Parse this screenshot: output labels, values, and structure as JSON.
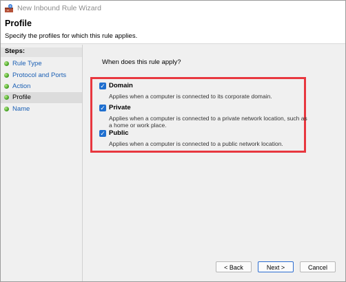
{
  "window": {
    "title": "New Inbound Rule Wizard"
  },
  "header": {
    "title": "Profile",
    "description": "Specify the profiles for which this rule applies."
  },
  "sidebar": {
    "steps_label": "Steps:",
    "steps": [
      {
        "label": "Rule Type",
        "active": false
      },
      {
        "label": "Protocol and Ports",
        "active": false
      },
      {
        "label": "Action",
        "active": false
      },
      {
        "label": "Profile",
        "active": true
      },
      {
        "label": "Name",
        "active": false
      }
    ]
  },
  "main": {
    "question": "When does this rule apply?",
    "options": [
      {
        "title": "Domain",
        "checked": true,
        "description": "Applies when a computer is connected to its corporate domain."
      },
      {
        "title": "Private",
        "checked": true,
        "description": "Applies when a computer is connected to a private network location, such as a home or work place."
      },
      {
        "title": "Public",
        "checked": true,
        "description": "Applies when a computer is connected to a public network location."
      }
    ]
  },
  "buttons": {
    "back": "< Back",
    "next": "Next >",
    "cancel": "Cancel"
  },
  "colors": {
    "accent": "#1f6fcf",
    "highlight_box": "#e8373f",
    "step_dot": "#3a9a1a"
  }
}
